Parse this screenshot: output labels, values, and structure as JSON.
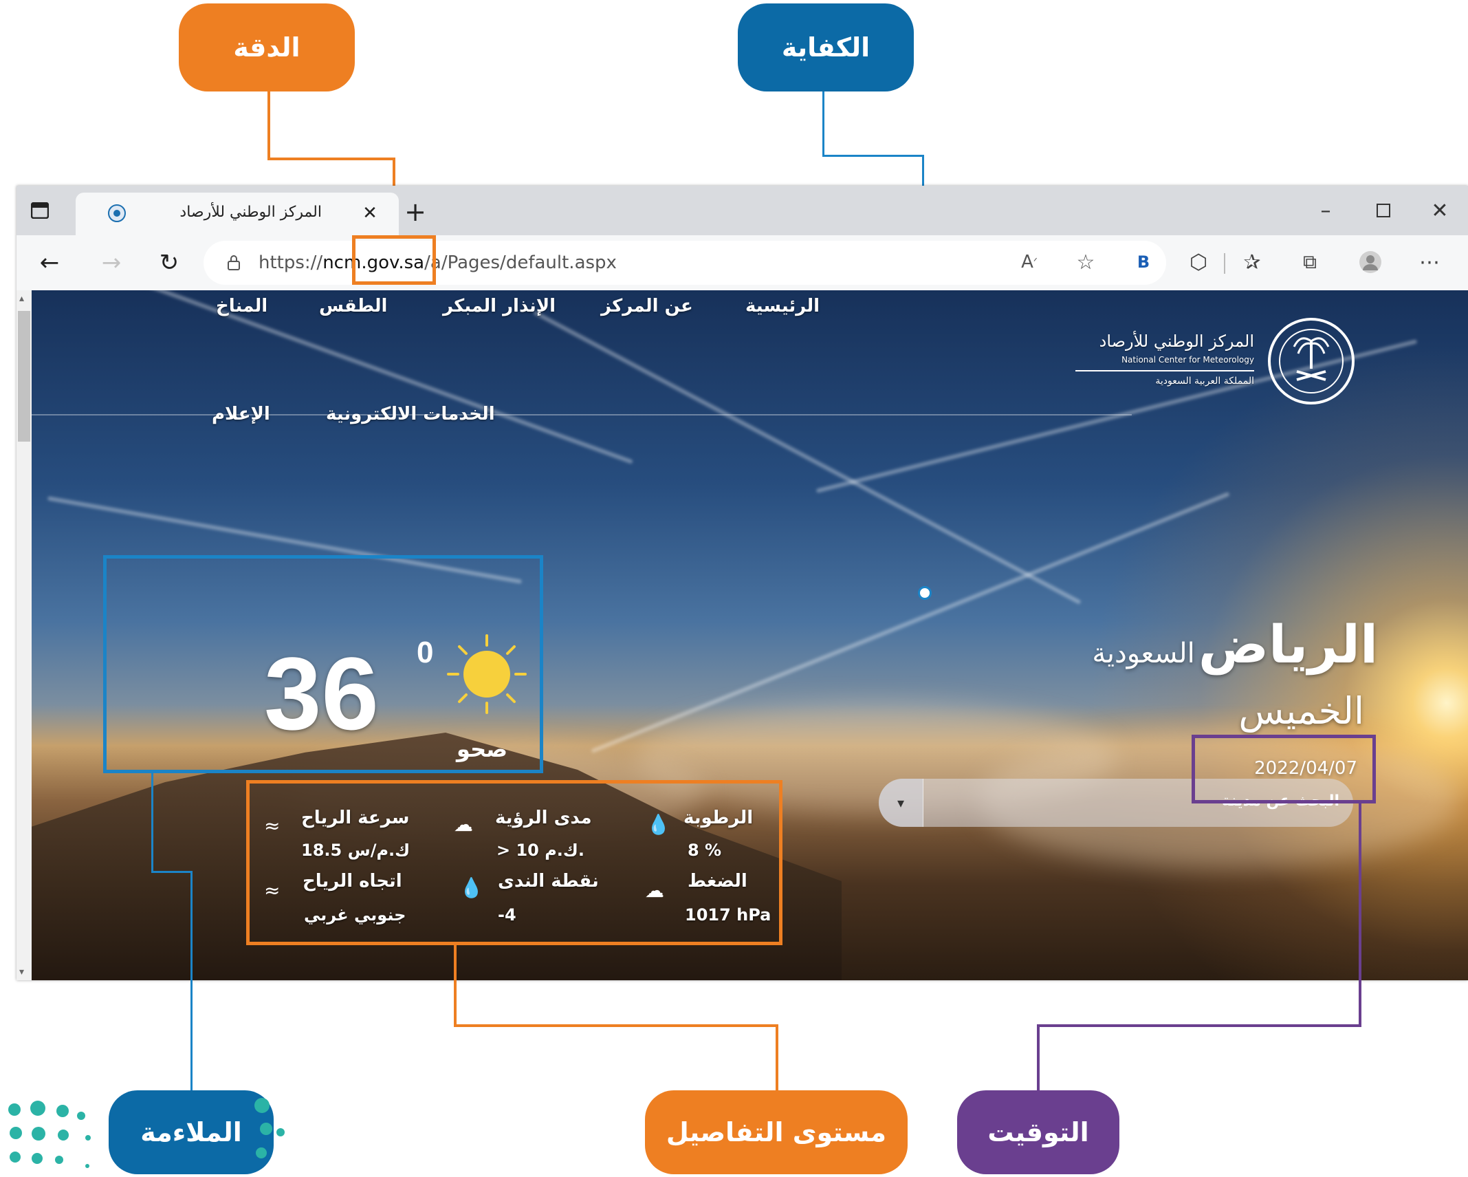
{
  "callouts": {
    "accuracy": "الدقة",
    "sufficiency": "الكفاية",
    "relevance": "الملاءمة",
    "detail_level": "مستوى التفاصيل",
    "timeliness": "التوقيت"
  },
  "browser": {
    "tab_title": "المركز الوطني للأرصاد",
    "url_prefix": "https://",
    "url_host_start": "ncm",
    "url_host_highlight": ".gov.sa",
    "url_path": "/a",
    "url_path_rest": "/Pages/default.aspx",
    "icons": [
      "tab-actions-icon",
      "site-info-icon",
      "close-tab-icon",
      "new-tab-icon",
      "minimize-icon",
      "maximize-icon",
      "close-window-icon",
      "back-icon",
      "forward-icon",
      "refresh-icon",
      "lock-icon",
      "read-aloud-icon",
      "add-favorite-icon",
      "bing-icon",
      "extensions-icon",
      "favorites-icon",
      "collections-icon",
      "profile-icon",
      "more-icon"
    ]
  },
  "site": {
    "nav": [
      "الرئيسية",
      "عن المركز",
      "الإنذار المبكر",
      "الطقس",
      "المناخ",
      "الخدمات الالكترونية",
      "الإعلام"
    ],
    "logo_ar": "المركز الوطني للأرصاد",
    "logo_en": "National Center for Meteorology",
    "logo_ar_sub": "المملكة العربية السعودية",
    "city": "الرياض",
    "country": "السعودية",
    "day": "الخميس",
    "date": "2022/04/07",
    "search_placeholder": "البحث عن مدينة",
    "temperature": "36",
    "degree": "0",
    "condition": "صحو",
    "details": {
      "humidity_label": "الرطوبة",
      "humidity_value": "8 %",
      "visibility_label": "مدى الرؤية",
      "visibility_value": "> 10 ك.م.",
      "wind_speed_label": "سرعة الرياح",
      "wind_speed_value": "18.5 ك.م/س",
      "pressure_label": "الضغط",
      "pressure_value": "1017 hPa",
      "dew_point_label": "نقطة الندى",
      "dew_point_value": "-4",
      "wind_dir_label": "اتجاه الرياح",
      "wind_dir_value": "جنوبي غربي"
    }
  },
  "colors": {
    "orange": "#ee7f22",
    "blue": "#0c6aa6",
    "purple": "#6a3f8f",
    "teal": "#2bb3a6"
  }
}
